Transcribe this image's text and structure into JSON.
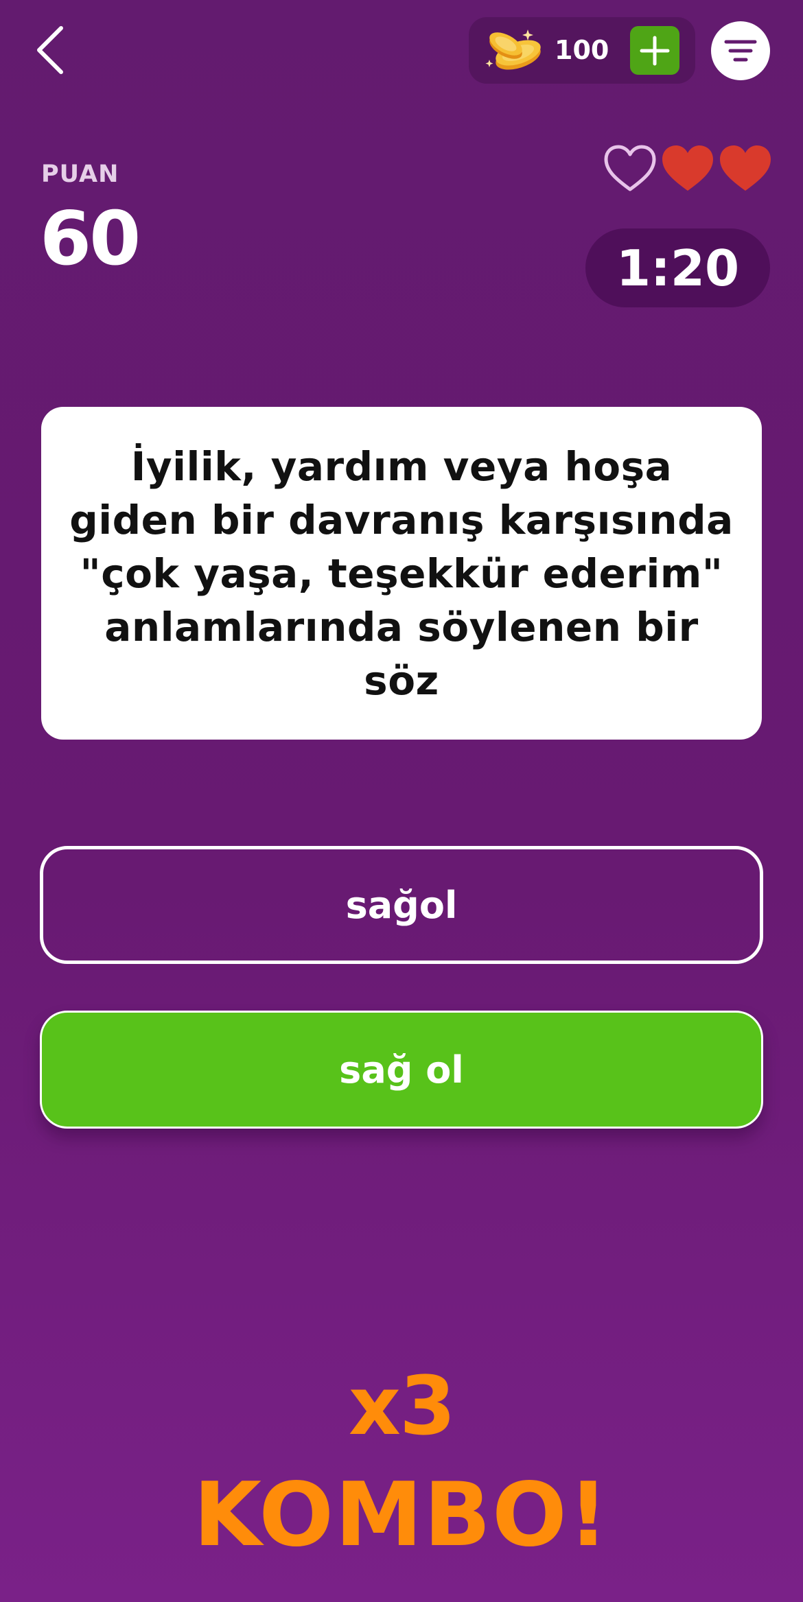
{
  "header": {
    "back_icon": "chevron-left-icon",
    "coins": {
      "icon": "coins-icon",
      "count": "100",
      "add_icon": "plus-icon",
      "add_color": "#4fa516"
    },
    "menu_icon": "filter-lines-icon"
  },
  "score": {
    "label": "PUAN",
    "value": "60"
  },
  "lives": {
    "total": 3,
    "remaining": 2,
    "icon": "heart-icon",
    "full_color": "#d93a2c"
  },
  "timer": {
    "value": "1:20"
  },
  "question": {
    "text": "İyilik, yardım veya hoşa giden bir davranış karşısında \"çok yaşa, teşekkür ederim\" anlamlarında söylenen bir söz"
  },
  "answers": [
    {
      "label": "sağol",
      "state": "default"
    },
    {
      "label": "sağ ol",
      "state": "correct",
      "color": "#58c21a"
    }
  ],
  "combo": {
    "multiplier": "x3",
    "label": "KOMBO!",
    "color": "#ff8c0a"
  }
}
